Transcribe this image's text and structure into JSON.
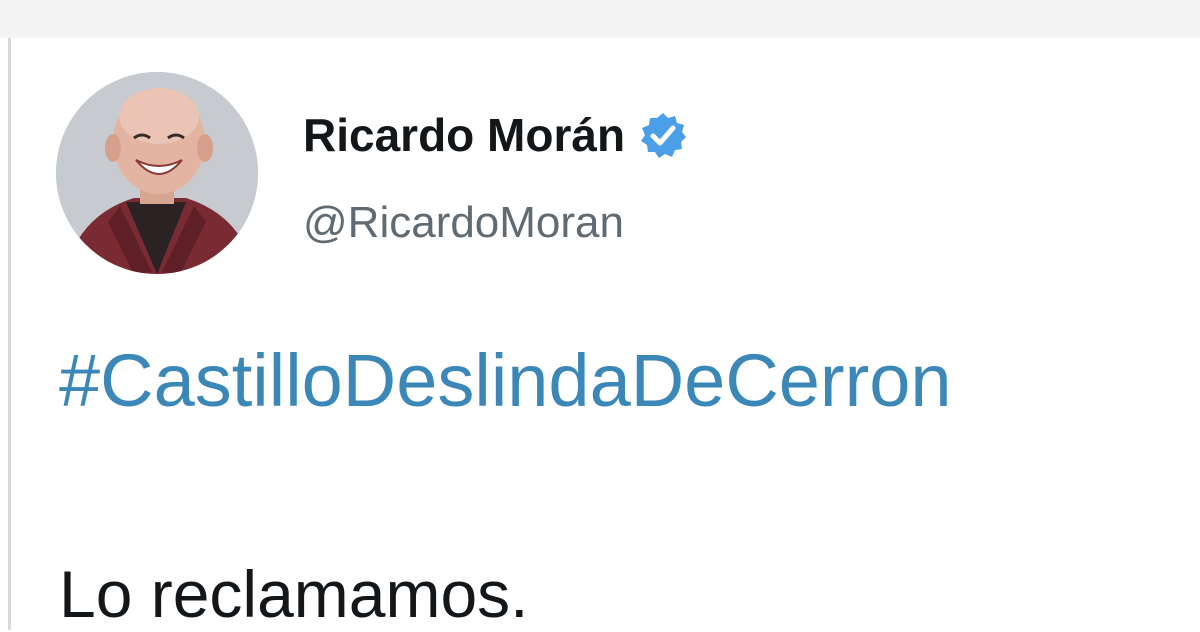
{
  "tweet": {
    "author": {
      "display_name": "Ricardo Morán",
      "handle": "@RicardoMoran",
      "verified": true,
      "avatar_icon": "profile-photo"
    },
    "hashtag": "#CastilloDeslindaDeCerron",
    "text": "Lo reclamamos."
  },
  "colors": {
    "hashtag": "#3b88b8",
    "verified_badge": "#4a9fe8",
    "name": "#14171a",
    "handle": "#606a72"
  }
}
